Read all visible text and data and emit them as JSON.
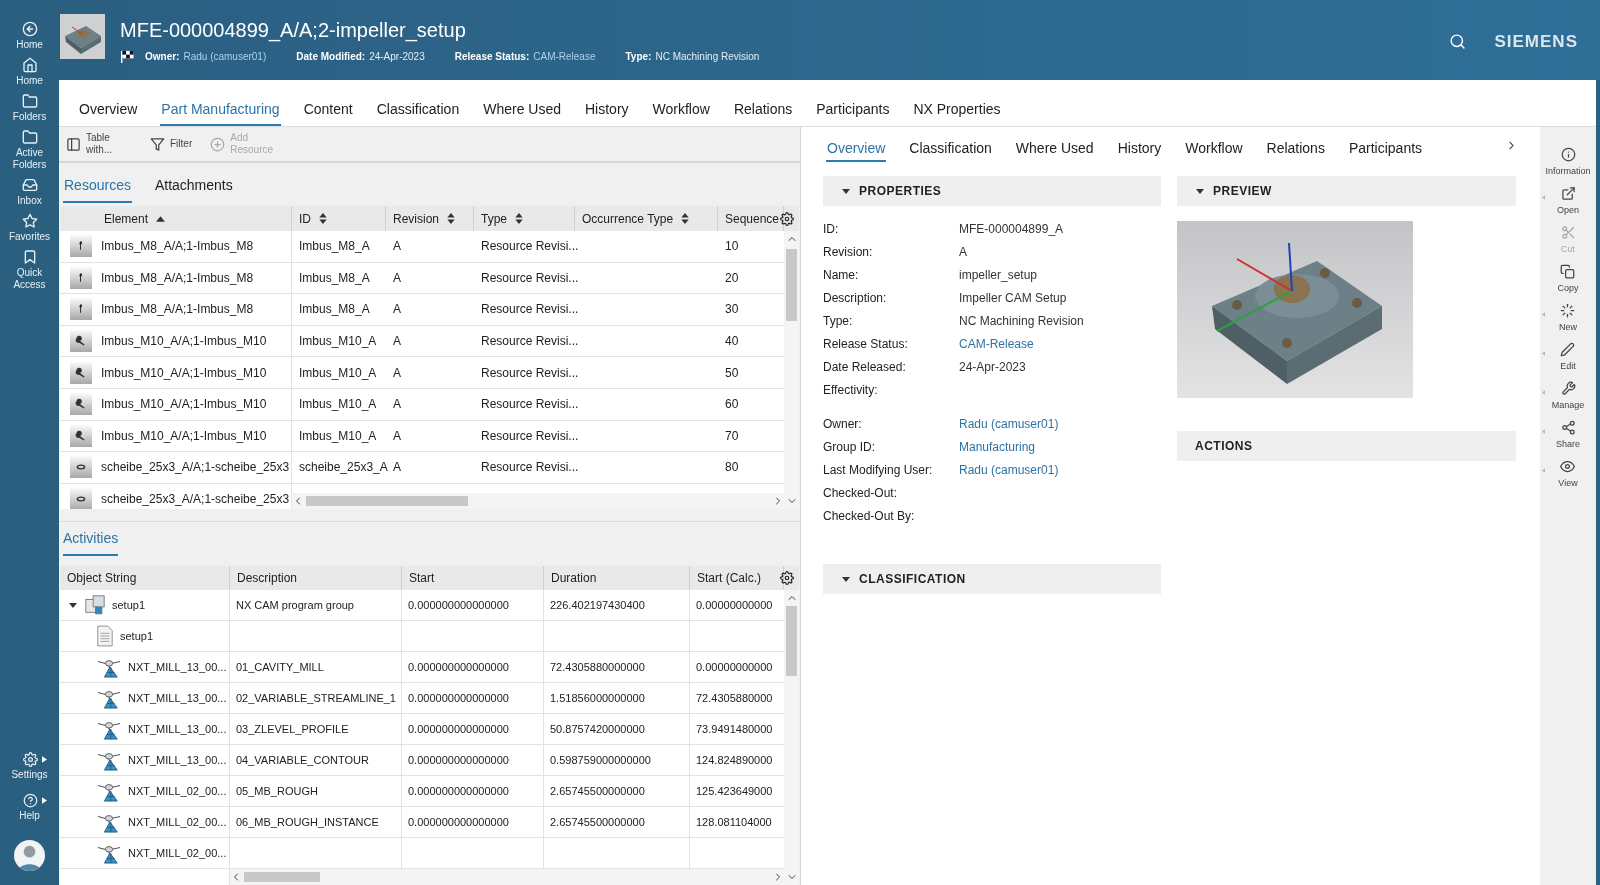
{
  "nav": {
    "items": [
      {
        "label": "Home"
      },
      {
        "label": "Home"
      },
      {
        "label": "Folders"
      },
      {
        "label": "Active Folders"
      },
      {
        "label": "Inbox"
      },
      {
        "label": "Favorites"
      },
      {
        "label": "Quick Access"
      }
    ],
    "bottom": [
      {
        "label": "Settings",
        "has_menu": true
      },
      {
        "label": "Help",
        "has_menu": true
      }
    ]
  },
  "header": {
    "title": "MFE-000004899_A/A;2-impeller_setup",
    "logo": "SIEMENS",
    "meta": [
      {
        "label": "Owner:",
        "value": "Radu (camuser01)",
        "link": true
      },
      {
        "label": "Date Modified:",
        "value": "24-Apr-2023",
        "link": false
      },
      {
        "label": "Release Status:",
        "value": "CAM-Release",
        "link": true
      },
      {
        "label": "Type:",
        "value": "NC Machining Revision",
        "link": false
      }
    ]
  },
  "tabs": [
    {
      "label": "Overview",
      "selected": false
    },
    {
      "label": "Part Manufacturing",
      "selected": true
    },
    {
      "label": "Content",
      "selected": false
    },
    {
      "label": "Classification",
      "selected": false
    },
    {
      "label": "Where Used",
      "selected": false
    },
    {
      "label": "History",
      "selected": false
    },
    {
      "label": "Workflow",
      "selected": false
    },
    {
      "label": "Relations",
      "selected": false
    },
    {
      "label": "Participants",
      "selected": false
    },
    {
      "label": "NX Properties",
      "selected": false
    }
  ],
  "toolbar": [
    {
      "label": "Table with...",
      "disabled": false
    },
    {
      "label": "Filter",
      "disabled": false
    },
    {
      "label": "Add Resource",
      "disabled": true
    }
  ],
  "resource_tabs": [
    {
      "label": "Resources",
      "selected": true
    },
    {
      "label": "Attachments",
      "selected": false
    }
  ],
  "resources": {
    "columns": [
      {
        "label": "Element",
        "sortable": true,
        "sorted": true
      },
      {
        "label": "ID",
        "sortable": true,
        "sorted": false
      },
      {
        "label": "Revision",
        "sortable": true,
        "sorted": false
      },
      {
        "label": "Type",
        "sortable": true,
        "sorted": false
      },
      {
        "label": "Occurrence Type",
        "sortable": true,
        "sorted": false
      },
      {
        "label": "Sequence",
        "sortable": false
      }
    ],
    "rows": [
      {
        "kind": "screw",
        "element": "Imbus_M8_A/A;1-Imbus_M8",
        "id": "Imbus_M8_A",
        "revision": "A",
        "type": "Resource Revisi...",
        "sequence": "10"
      },
      {
        "kind": "screw",
        "element": "Imbus_M8_A/A;1-Imbus_M8",
        "id": "Imbus_M8_A",
        "revision": "A",
        "type": "Resource Revisi...",
        "sequence": "20"
      },
      {
        "kind": "screw",
        "element": "Imbus_M8_A/A;1-Imbus_M8",
        "id": "Imbus_M8_A",
        "revision": "A",
        "type": "Resource Revisi...",
        "sequence": "30"
      },
      {
        "kind": "key",
        "element": "Imbus_M10_A/A;1-Imbus_M10",
        "id": "Imbus_M10_A",
        "revision": "A",
        "type": "Resource Revisi...",
        "sequence": "40"
      },
      {
        "kind": "key",
        "element": "Imbus_M10_A/A;1-Imbus_M10",
        "id": "Imbus_M10_A",
        "revision": "A",
        "type": "Resource Revisi...",
        "sequence": "50"
      },
      {
        "kind": "key",
        "element": "Imbus_M10_A/A;1-Imbus_M10",
        "id": "Imbus_M10_A",
        "revision": "A",
        "type": "Resource Revisi...",
        "sequence": "60"
      },
      {
        "kind": "key",
        "element": "Imbus_M10_A/A;1-Imbus_M10",
        "id": "Imbus_M10_A",
        "revision": "A",
        "type": "Resource Revisi...",
        "sequence": "70"
      },
      {
        "kind": "washer",
        "element": "scheibe_25x3_A/A;1-scheibe_25x3",
        "id": "scheibe_25x3_A",
        "revision": "A",
        "type": "Resource Revisi...",
        "sequence": "80"
      },
      {
        "kind": "washer",
        "element": "scheibe_25x3_A/A;1-scheibe_25x3"
      }
    ]
  },
  "activities": {
    "title": "Activities",
    "columns": [
      "Object String",
      "Description",
      "Start",
      "Duration",
      "Start (Calc.)"
    ],
    "rows": [
      {
        "kind": "group",
        "object": "setup1",
        "expanded": true,
        "description": "NX CAM program group",
        "start": "0.000000000000000",
        "duration": "226.402197430400",
        "start_calc": "0.00000000000",
        "children": [
          {
            "kind": "file",
            "object": "setup1"
          },
          {
            "kind": "operation",
            "object": "NXT_MILL_13_00...",
            "description": "01_CAVITY_MILL",
            "start": "0.000000000000000",
            "duration": "72.4305880000000",
            "start_calc": "0.00000000000"
          },
          {
            "kind": "operation",
            "object": "NXT_MILL_13_00...",
            "description": "02_VARIABLE_STREAMLINE_1",
            "start": "0.000000000000000",
            "duration": "1.51856000000000",
            "start_calc": "72.4305880000"
          },
          {
            "kind": "operation",
            "object": "NXT_MILL_13_00...",
            "description": "03_ZLEVEL_PROFILE",
            "start": "0.000000000000000",
            "duration": "50.8757420000000",
            "start_calc": "73.9491480000"
          },
          {
            "kind": "operation",
            "object": "NXT_MILL_13_00...",
            "description": "04_VARIABLE_CONTOUR",
            "start": "0.000000000000000",
            "duration": "0.598759000000000",
            "start_calc": "124.824890000"
          },
          {
            "kind": "operation",
            "object": "NXT_MILL_02_00...",
            "description": "05_MB_ROUGH",
            "start": "0.000000000000000",
            "duration": "2.65745500000000",
            "start_calc": "125.423649000"
          },
          {
            "kind": "operation",
            "object": "NXT_MILL_02_00...",
            "description": "06_MB_ROUGH_INSTANCE",
            "start": "0.000000000000000",
            "duration": "2.65745500000000",
            "start_calc": "128.081104000"
          },
          {
            "kind": "operation",
            "object": "NXT_MILL_02_00..."
          }
        ]
      }
    ]
  },
  "detail_tabs": [
    {
      "label": "Overview",
      "selected": true
    },
    {
      "label": "Classification",
      "selected": false
    },
    {
      "label": "Where Used",
      "selected": false
    },
    {
      "label": "History",
      "selected": false
    },
    {
      "label": "Workflow",
      "selected": false
    },
    {
      "label": "Relations",
      "selected": false
    },
    {
      "label": "Participants",
      "selected": false
    }
  ],
  "properties": {
    "title": "PROPERTIES",
    "expanded": true,
    "groups": [
      [
        {
          "label": "ID:",
          "value": "MFE-000004899_A",
          "link": false
        },
        {
          "label": "Revision:",
          "value": "A",
          "link": false
        },
        {
          "label": "Name:",
          "value": "impeller_setup",
          "link": false
        },
        {
          "label": "Description:",
          "value": "Impeller CAM Setup",
          "link": false
        },
        {
          "label": "Type:",
          "value": "NC Machining Revision",
          "link": false
        },
        {
          "label": "Release Status:",
          "value": "CAM-Release",
          "link": true
        },
        {
          "label": "Date Released:",
          "value": "24-Apr-2023",
          "link": false
        },
        {
          "label": "Effectivity:"
        }
      ],
      [
        {
          "label": "Owner:",
          "value": "Radu (camuser01)",
          "link": true
        },
        {
          "label": "Group ID:",
          "value": "Manufacturing",
          "link": true
        },
        {
          "label": "Last Modifying User:",
          "value": "Radu (camuser01)",
          "link": true
        },
        {
          "label": "Checked-Out:"
        },
        {
          "label": "Checked-Out By:"
        }
      ]
    ]
  },
  "classification": {
    "title": "CLASSIFICATION",
    "expanded": true
  },
  "preview": {
    "title": "PREVIEW",
    "expanded": true
  },
  "actions": {
    "title": "ACTIONS"
  },
  "commands": [
    {
      "label": "Information",
      "disabled": false,
      "has_menu": false
    },
    {
      "label": "Open",
      "disabled": false,
      "has_menu": true
    },
    {
      "label": "Cut",
      "disabled": true,
      "has_menu": false
    },
    {
      "label": "Copy",
      "disabled": false,
      "has_menu": false
    },
    {
      "label": "New",
      "disabled": false,
      "has_menu": true
    },
    {
      "label": "Edit",
      "disabled": false,
      "has_menu": true
    },
    {
      "label": "Manage",
      "disabled": false,
      "has_menu": true
    },
    {
      "label": "Share",
      "disabled": false,
      "has_menu": true
    },
    {
      "label": "View",
      "disabled": false,
      "has_menu": true
    }
  ]
}
